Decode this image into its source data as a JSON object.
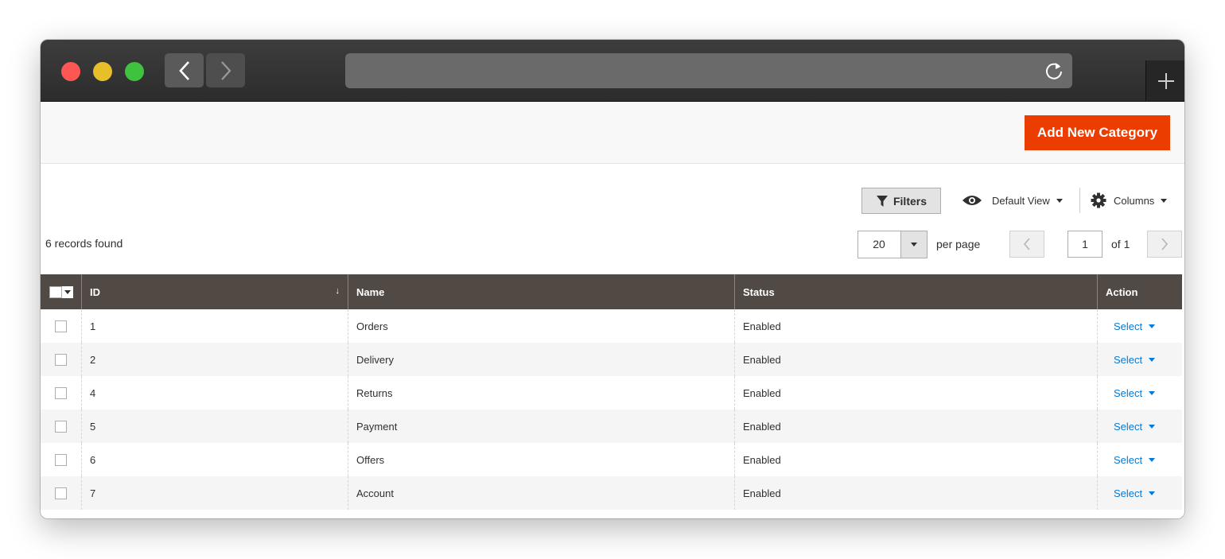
{
  "browser": {
    "url": "",
    "icons": [
      "chevron-left-icon",
      "chevron-right-icon",
      "reload-icon",
      "plus-icon"
    ]
  },
  "header": {
    "add_button": "Add New Category"
  },
  "toolbar": {
    "filters": "Filters",
    "view": "Default View",
    "columns": "Columns"
  },
  "pager": {
    "records": "6 records found",
    "per_page_value": "20",
    "per_page_label": "per page",
    "page": "1",
    "of": "of 1"
  },
  "table": {
    "headers": {
      "id": "ID",
      "name": "Name",
      "status": "Status",
      "action": "Action",
      "sort_indicator": "↓"
    },
    "rows": [
      {
        "id": "1",
        "name": "Orders",
        "status": "Enabled",
        "action": "Select"
      },
      {
        "id": "2",
        "name": "Delivery",
        "status": "Enabled",
        "action": "Select"
      },
      {
        "id": "4",
        "name": "Returns",
        "status": "Enabled",
        "action": "Select"
      },
      {
        "id": "5",
        "name": "Payment",
        "status": "Enabled",
        "action": "Select"
      },
      {
        "id": "6",
        "name": "Offers",
        "status": "Enabled",
        "action": "Select"
      },
      {
        "id": "7",
        "name": "Account",
        "status": "Enabled",
        "action": "Select"
      }
    ]
  },
  "colors": {
    "accent": "#eb3d00",
    "header_bg": "#514943",
    "link": "#007bdb"
  }
}
